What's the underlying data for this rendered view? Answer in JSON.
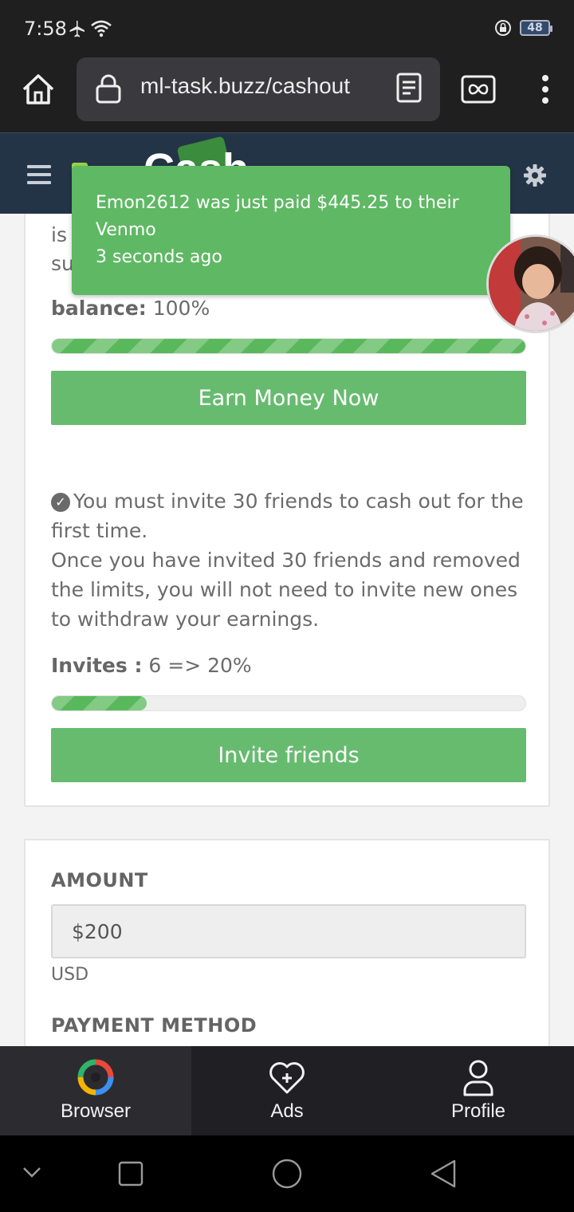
{
  "status_bar": {
    "time": "7:58",
    "battery": "48"
  },
  "browser": {
    "url": "ml-task.buzz/cashout"
  },
  "site": {
    "logo_text": "Cash"
  },
  "toast": {
    "message": "Emon2612 was just paid $445.25 to their Venmo",
    "time_ago": "3 seconds ago"
  },
  "card1": {
    "partial_line1": "is",
    "partial_line2": "su",
    "balance_label": "balance:",
    "balance_value": "100%",
    "balance_progress": 1.0,
    "earn_button": "Earn Money Now",
    "notice_line1": "You must invite 30 friends to cash out for the first time.",
    "notice_line2": "Once you have invited 30 friends and removed the limits, you will not need to invite new ones to withdraw your earnings.",
    "invites_label": "Invites :",
    "invites_value": "6 => 20%",
    "invites_progress": 0.2,
    "invite_button": "Invite friends"
  },
  "card2": {
    "amount_label": "AMOUNT",
    "amount_value": "$200",
    "currency": "USD",
    "payment_method_label": "PAYMENT METHOD"
  },
  "bottom_nav": [
    {
      "label": "Browser",
      "icon": "browser-logo-icon",
      "active": true
    },
    {
      "label": "Ads",
      "icon": "heart-plus-icon",
      "active": false
    },
    {
      "label": "Profile",
      "icon": "person-icon",
      "active": false
    }
  ],
  "colors": {
    "accent_green": "#67bb6f",
    "toast_green": "#5fb864",
    "header_navy": "#243447",
    "browser_chrome": "#1f1f1f"
  }
}
